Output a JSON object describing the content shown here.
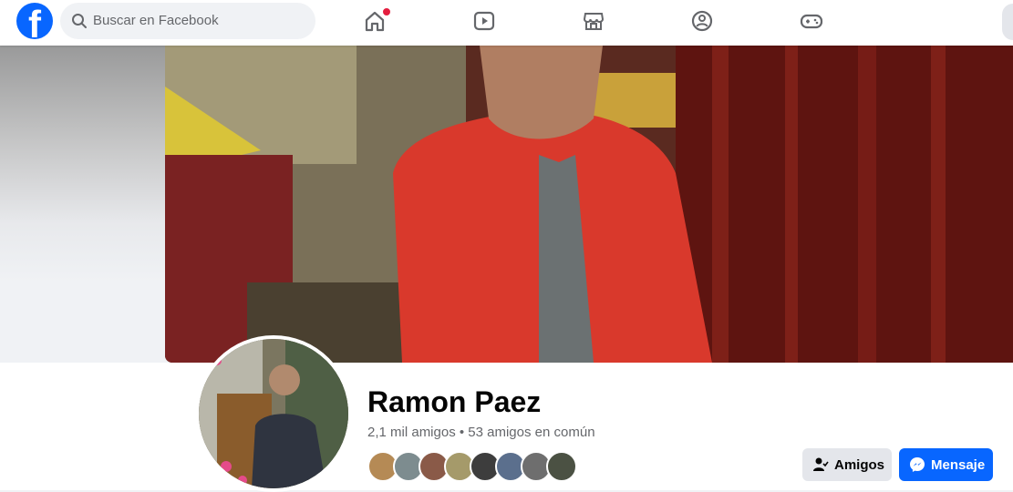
{
  "topbar": {
    "search_placeholder": "Buscar en Facebook",
    "nav": [
      "home-icon",
      "video-icon",
      "marketplace-icon",
      "groups-icon",
      "gaming-icon"
    ],
    "home_has_notification": true
  },
  "profile": {
    "name": "Ramon Paez",
    "stats": "2,1 mil amigos • 53 amigos en común",
    "mutual_friend_avatars": 8
  },
  "actions": {
    "friends_label": "Amigos",
    "message_label": "Mensaje"
  },
  "colors": {
    "brand": "#0866ff",
    "notification": "#e41e3f",
    "secondary_button": "#e4e6eb"
  }
}
